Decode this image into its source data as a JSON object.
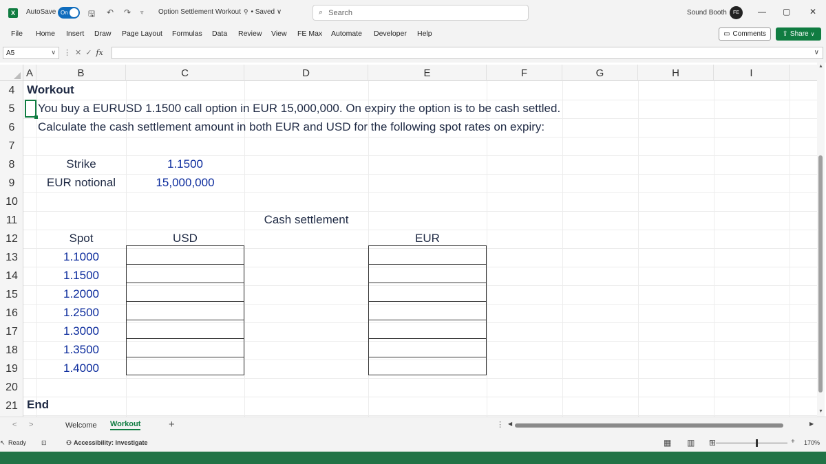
{
  "app": {
    "logo": "X",
    "autosave_label": "AutoSave",
    "autosave_state": "On",
    "doc_title": "Option Settlement Workout",
    "saved_status": "• Saved ∨",
    "search_placeholder": "Search",
    "user_name": "Sound Booth",
    "avatar_initials": "FE",
    "window_controls": [
      "—",
      "▢",
      "✕"
    ]
  },
  "ribbon": {
    "tabs": [
      "File",
      "Home",
      "Insert",
      "Draw",
      "Page Layout",
      "Formulas",
      "Data",
      "Review",
      "View",
      "FE Max",
      "Automate",
      "Developer",
      "Help"
    ],
    "comments_label": "Comments",
    "share_label": "Share"
  },
  "formula_bar": {
    "name_box": "A5",
    "fx_label": "fx",
    "cancel_glyph": "✕",
    "enter_glyph": "✓",
    "value": ""
  },
  "columns": [
    "A",
    "B",
    "C",
    "D",
    "E",
    "F",
    "G",
    "H",
    "I"
  ],
  "rows": [
    "4",
    "5",
    "6",
    "7",
    "8",
    "9",
    "10",
    "11",
    "12",
    "13",
    "14",
    "15",
    "16",
    "17",
    "18",
    "19",
    "20",
    "21"
  ],
  "sheet": {
    "heading": "Workout",
    "line1": "You buy a EURUSD 1.1500 call option in EUR 15,000,000. On expiry the option is to be cash settled.",
    "line2": "Calculate the cash settlement amount in both EUR and USD for the following spot rates on expiry:",
    "strike_label": "Strike",
    "strike_value": "1.1500",
    "notional_label": "EUR notional",
    "notional_value": "15,000,000",
    "settlement_header": "Cash settlement",
    "spot_header": "Spot",
    "usd_header": "USD",
    "eur_header": "EUR",
    "spots": [
      "1.1000",
      "1.1500",
      "1.2000",
      "1.2500",
      "1.3000",
      "1.3500",
      "1.4000"
    ],
    "end_label": "End"
  },
  "sheet_tabs": {
    "tabs": [
      "Welcome",
      "Workout"
    ],
    "active": "Workout",
    "add_glyph": "+"
  },
  "status": {
    "ready": "Ready",
    "accessibility": "Accessibility: Investigate",
    "zoom": "170%"
  }
}
